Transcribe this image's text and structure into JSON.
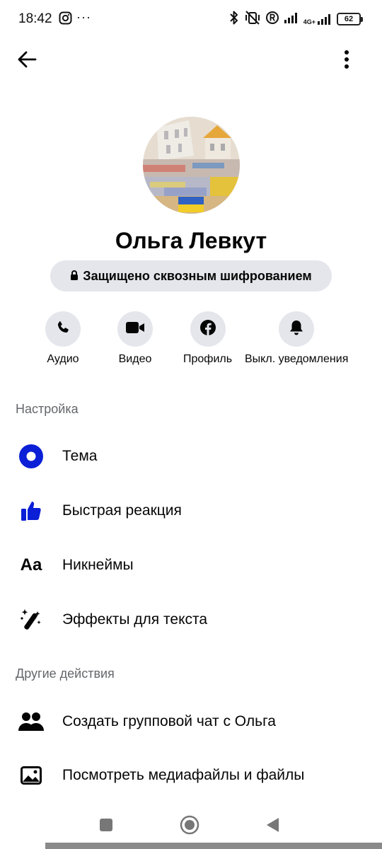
{
  "status_bar": {
    "time": "18:42",
    "dots": "···",
    "network": "4G+",
    "battery": "62"
  },
  "header": {
    "back_icon": "arrow-left-icon",
    "menu_icon": "more-vertical-icon"
  },
  "profile": {
    "name": "Ольга Левкут",
    "encryption_label": "Защищено сквозным шифрованием"
  },
  "actions": [
    {
      "label": "Аудио",
      "icon": "phone-icon"
    },
    {
      "label": "Видео",
      "icon": "video-camera-icon"
    },
    {
      "label": "Профиль",
      "icon": "facebook-icon"
    },
    {
      "label": "Выкл. уведомления",
      "icon": "bell-icon"
    }
  ],
  "settings_section": {
    "title": "Настройка",
    "items": [
      {
        "label": "Тема",
        "icon": "theme-icon"
      },
      {
        "label": "Быстрая реакция",
        "icon": "thumbs-up-icon"
      },
      {
        "label": "Никнеймы",
        "icon": "nickname-icon",
        "icon_text": "Aa"
      },
      {
        "label": "Эффекты для текста",
        "icon": "magic-wand-icon"
      }
    ]
  },
  "other_section": {
    "title": "Другие действия",
    "items": [
      {
        "label": "Создать групповой чат с Ольга",
        "icon": "group-icon"
      },
      {
        "label": "Посмотреть медиафайлы и файлы",
        "icon": "image-icon"
      }
    ]
  },
  "colors": {
    "accent": "#0a1fd6",
    "chip_bg": "#e4e6eb",
    "secondary_text": "#65676b"
  }
}
